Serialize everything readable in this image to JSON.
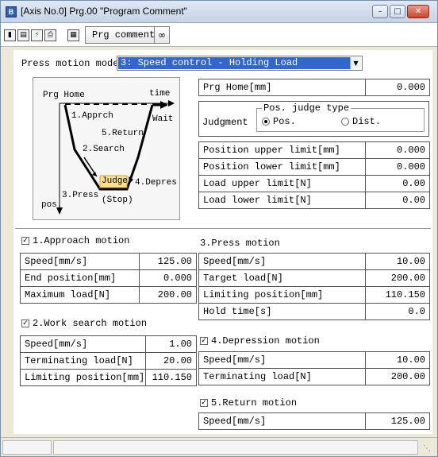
{
  "window": {
    "title": "[Axis No.0] Prg.00 \"Program Comment\"",
    "icon": "app-icon"
  },
  "toolbar": {
    "prg_comment_label": "Prg comment"
  },
  "press_motion_mode": {
    "label": "Press motion mode",
    "value": "3: Speed control - Holding Load"
  },
  "diagram": {
    "prg_home": "Prg Home",
    "time": "time",
    "pos": "pos.",
    "approach": "1.Apprch",
    "search": "2.Search",
    "press": "3.Press",
    "judge": "Judge",
    "stop": "(Stop)",
    "depress": "4.Depres",
    "return": "5.Return",
    "wait": "Wait",
    "judge_color": "#ffe08a"
  },
  "prg_home": {
    "label": "Prg Home[mm]",
    "value": "0.000"
  },
  "judgment": {
    "label": "Judgment",
    "type_label": "Pos. judge type",
    "opt_pos": "Pos.",
    "opt_dist": "Dist.",
    "selected": "Pos."
  },
  "limits": [
    {
      "label": "Position upper limit[mm]",
      "value": "0.000"
    },
    {
      "label": "Position lower limit[mm]",
      "value": "0.000"
    },
    {
      "label": "Load upper limit[N]",
      "value": "0.00"
    },
    {
      "label": "Load lower limit[N]",
      "value": "0.00"
    }
  ],
  "approach": {
    "title": "1.Approach motion",
    "checked": true,
    "rows": [
      {
        "label": "Speed[mm/s]",
        "value": "125.00"
      },
      {
        "label": "End position[mm]",
        "value": "0.000"
      },
      {
        "label": "Maximum load[N]",
        "value": "200.00"
      }
    ]
  },
  "search": {
    "title": "2.Work search motion",
    "checked": true,
    "rows": [
      {
        "label": "Speed[mm/s]",
        "value": "1.00"
      },
      {
        "label": "Terminating load[N]",
        "value": "20.00"
      },
      {
        "label": "Limiting position[mm]",
        "value": "110.150"
      }
    ]
  },
  "press": {
    "title": "3.Press motion",
    "rows": [
      {
        "label": "Speed[mm/s]",
        "value": "10.00"
      },
      {
        "label": "Target load[N]",
        "value": "200.00"
      },
      {
        "label": "Limiting position[mm]",
        "value": "110.150"
      },
      {
        "label": "Hold time[s]",
        "value": "0.0"
      }
    ]
  },
  "depress": {
    "title": "4.Depression motion",
    "checked": true,
    "rows": [
      {
        "label": "Speed[mm/s]",
        "value": "10.00"
      },
      {
        "label": "Terminating load[N]",
        "value": "200.00"
      }
    ]
  },
  "return": {
    "title": "5.Return motion",
    "checked": true,
    "rows": [
      {
        "label": "Speed[mm/s]",
        "value": "125.00"
      }
    ]
  }
}
